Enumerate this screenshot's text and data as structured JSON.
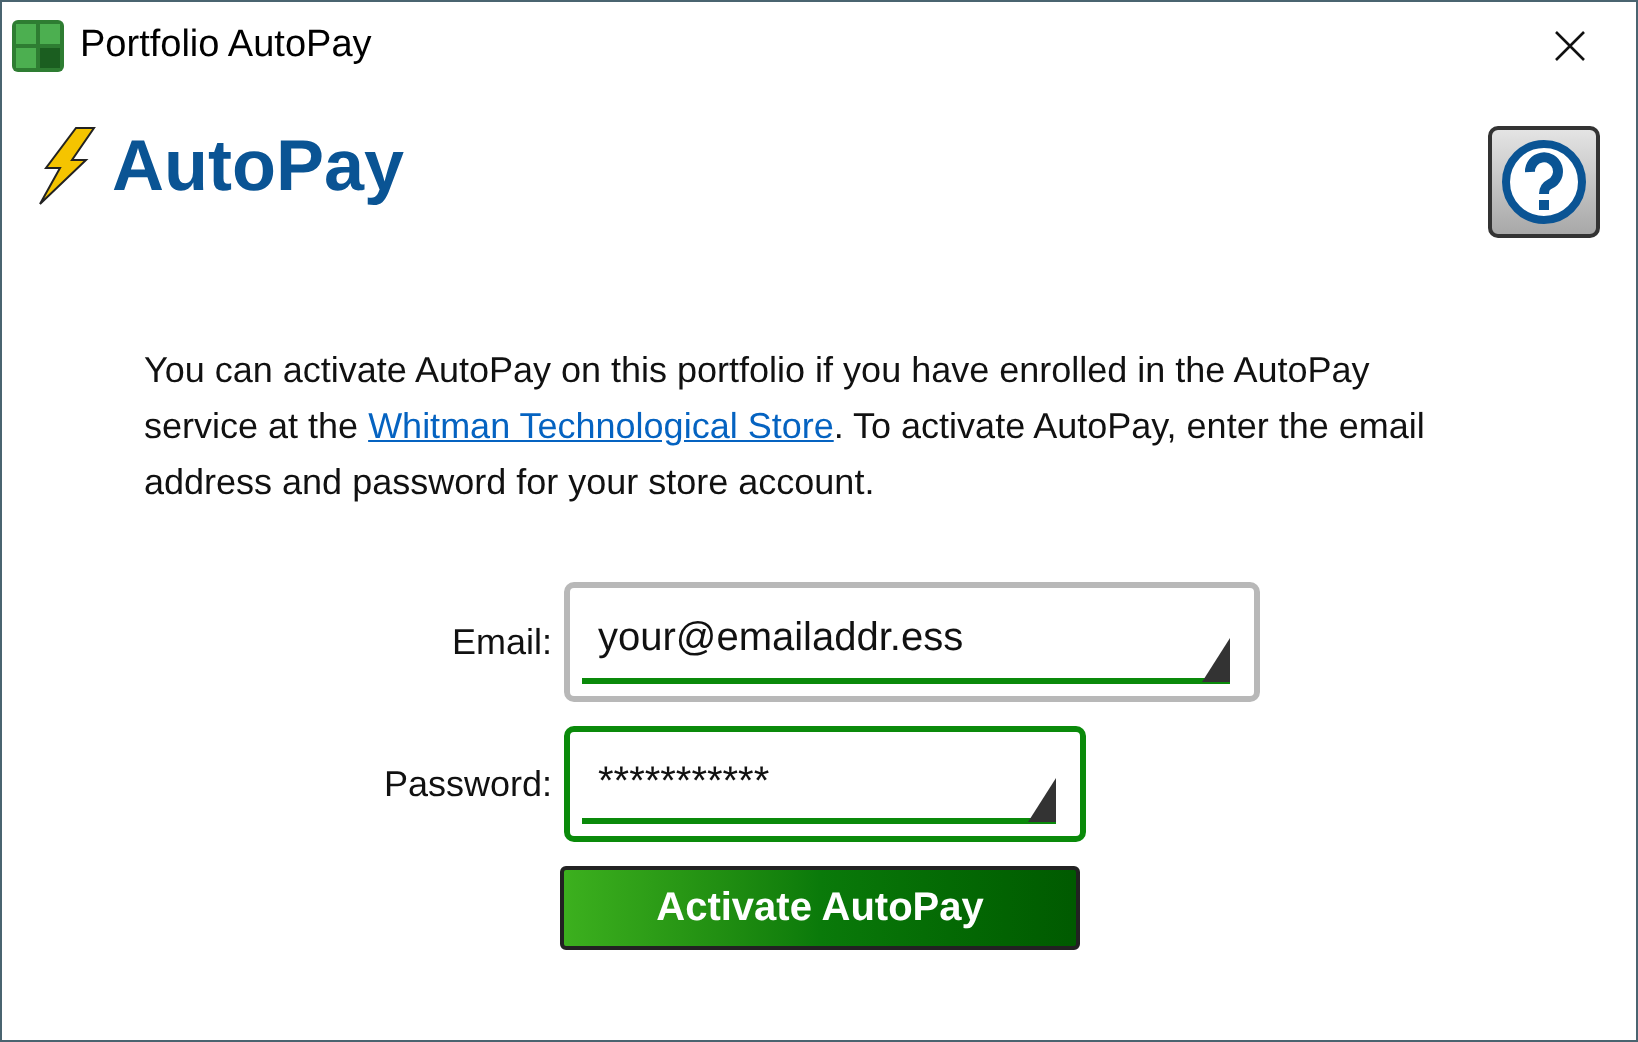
{
  "window": {
    "title": "Portfolio AutoPay"
  },
  "logo": {
    "text": "AutoPay"
  },
  "intro": {
    "before": "You can activate AutoPay on this portfolio if you have enrolled in the AutoPay service at the ",
    "link": "Whitman Technological Store",
    "after": ". To activate AutoPay, enter the email address and password for your store account."
  },
  "fields": [
    {
      "label": "Email:",
      "value": "your@emailaddr.ess",
      "focused": false
    },
    {
      "label": "Password:",
      "value": "***********",
      "focused": true
    }
  ],
  "button": {
    "label": "Activate AutoPay"
  }
}
